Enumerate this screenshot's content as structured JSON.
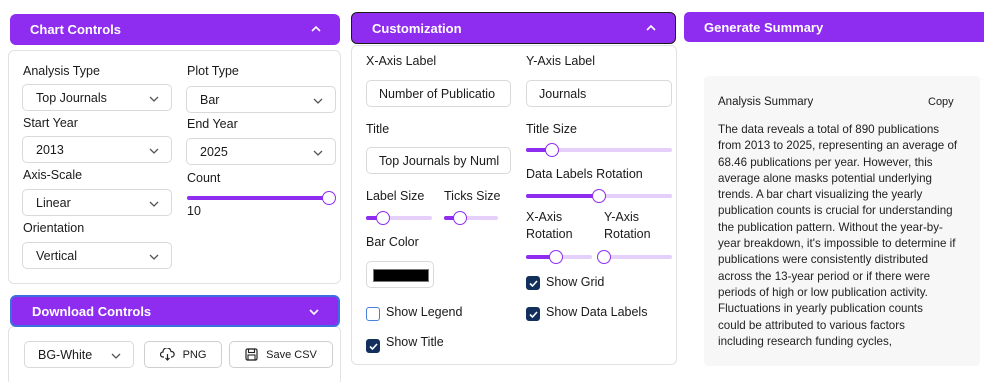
{
  "chart_controls": {
    "title": "Chart Controls",
    "analysis_type": {
      "label": "Analysis Type",
      "value": "Top Journals"
    },
    "plot_type": {
      "label": "Plot Type",
      "value": "Bar"
    },
    "start_year": {
      "label": "Start Year",
      "value": "2013"
    },
    "end_year": {
      "label": "End Year",
      "value": "2025"
    },
    "axis_scale": {
      "label": "Axis-Scale",
      "value": "Linear"
    },
    "count": {
      "label": "Count",
      "value": "10",
      "level": 1.0
    },
    "orientation": {
      "label": "Orientation",
      "value": "Vertical"
    }
  },
  "download_controls": {
    "title": "Download Controls",
    "bg_select": "BG-White",
    "png_label": "PNG",
    "save_csv_label": "Save CSV"
  },
  "customization": {
    "title": "Customization",
    "x_axis_label": {
      "label": "X-Axis Label",
      "value": "Number of Publicatio"
    },
    "y_axis_label": {
      "label": "Y-Axis Label",
      "value": "Journals"
    },
    "title_field": {
      "label": "Title",
      "value": "Top Journals by Numl"
    },
    "title_size": {
      "label": "Title Size",
      "level": 0.18
    },
    "label_size": {
      "label": "Label Size",
      "level": 0.25
    },
    "ticks_size": {
      "label": "Ticks Size",
      "level": 0.3
    },
    "data_labels_rotation": {
      "label": "Data Labels Rotation",
      "level": 0.5
    },
    "x_axis_rotation": {
      "label_line1": "X-Axis",
      "label_line2": "Rotation",
      "level": 0.45
    },
    "y_axis_rotation": {
      "label_line1": "Y-Axis",
      "label_line2": "Rotation",
      "level": 0.0
    },
    "bar_color": {
      "label": "Bar Color",
      "value": "#000000"
    },
    "show_grid": {
      "label": "Show Grid",
      "checked": true
    },
    "show_legend": {
      "label": "Show Legend",
      "checked": false
    },
    "show_data_labels": {
      "label": "Show Data Labels",
      "checked": true
    },
    "show_title": {
      "label": "Show Title",
      "checked": true
    }
  },
  "summary": {
    "button_label": "Generate Summary",
    "heading": "Analysis Summary",
    "copy_label": "Copy",
    "lines": [
      "The data reveals a total of 890 publications",
      "from 2013 to 2025, representing an average of",
      "68.46 publications per year. However, this",
      "average alone masks potential underlying",
      "trends. A bar chart visualizing the yearly",
      "publication counts is crucial for understanding",
      "the publication pattern. Without the year-by-",
      "year breakdown, it's impossible to determine if",
      "publications were consistently distributed",
      "across the 13-year period or if there were",
      "periods of high or low publication activity.",
      "Fluctuations in yearly publication counts",
      "could be attributed to various factors",
      "including research funding cycles,"
    ]
  },
  "colors": {
    "accent": "#8e2cf0",
    "slider_track": "#e4d0fb",
    "checkbox_checked": "#13305c",
    "download_border": "#3b6fe0",
    "customization_border": "#1a1a1a"
  },
  "icons": {
    "chevron_up": "chevron-up-icon",
    "chevron_down": "chevron-down-icon",
    "png": "cloud-download-icon",
    "csv": "save-icon",
    "check": "check-icon"
  }
}
